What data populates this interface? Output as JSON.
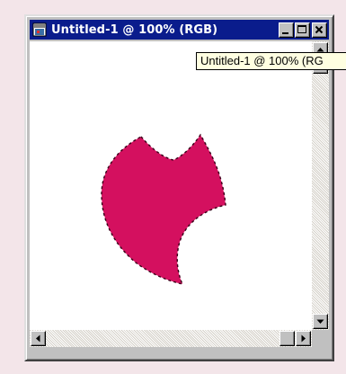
{
  "window": {
    "title": "Untitled-1 @ 100% (RGB)",
    "buttons": {
      "minimize_icon": "minimize-icon",
      "maximize_icon": "maximize-icon",
      "close_icon": "close-icon"
    }
  },
  "tooltip": {
    "text": "Untitled-1 @ 100% (RG"
  },
  "canvas": {
    "shape_color": "#d4105f",
    "selection": "marching-ants"
  },
  "colors": {
    "titlebar": "#0a1c8c",
    "background": "#f3e5e9",
    "chrome": "#c0c0c0"
  }
}
